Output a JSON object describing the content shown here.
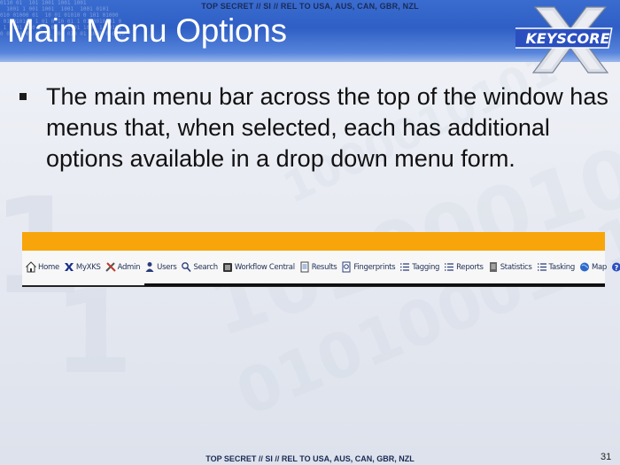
{
  "classification": {
    "top": "TOP SECRET // SI // REL TO USA, AUS, CAN, GBR, NZL",
    "bottom": "TOP SECRET // SI // REL TO USA, AUS, CAN, GBR, NZL"
  },
  "slide": {
    "title": "Main Menu Options",
    "bullet": "The main menu bar across the top of the window has menus that, when selected, each has additional options available in a drop down menu form.",
    "page_number": "31",
    "logo_text": "KEYSCORE"
  },
  "menu": {
    "items": [
      {
        "label": "Home",
        "icon": "home-icon"
      },
      {
        "label": "MyXKS",
        "icon": "x-icon"
      },
      {
        "label": "Admin",
        "icon": "tools-icon"
      },
      {
        "label": "Users",
        "icon": "user-icon"
      },
      {
        "label": "Search",
        "icon": "search-icon"
      },
      {
        "label": "Workflow Central",
        "icon": "workflow-icon"
      },
      {
        "label": "Results",
        "icon": "results-icon"
      },
      {
        "label": "Fingerprints",
        "icon": "fingerprint-icon"
      },
      {
        "label": "Tagging",
        "icon": "list-icon"
      },
      {
        "label": "Reports",
        "icon": "list-icon"
      },
      {
        "label": "Statistics",
        "icon": "statistics-icon"
      },
      {
        "label": "Tasking",
        "icon": "list-icon"
      },
      {
        "label": "Map",
        "icon": "globe-icon"
      },
      {
        "label": "Help",
        "icon": "help-icon"
      }
    ]
  },
  "colors": {
    "header_blue": "#2f5fc4",
    "menu_orange": "#f7a50a",
    "menu_text": "#1e2f55"
  }
}
